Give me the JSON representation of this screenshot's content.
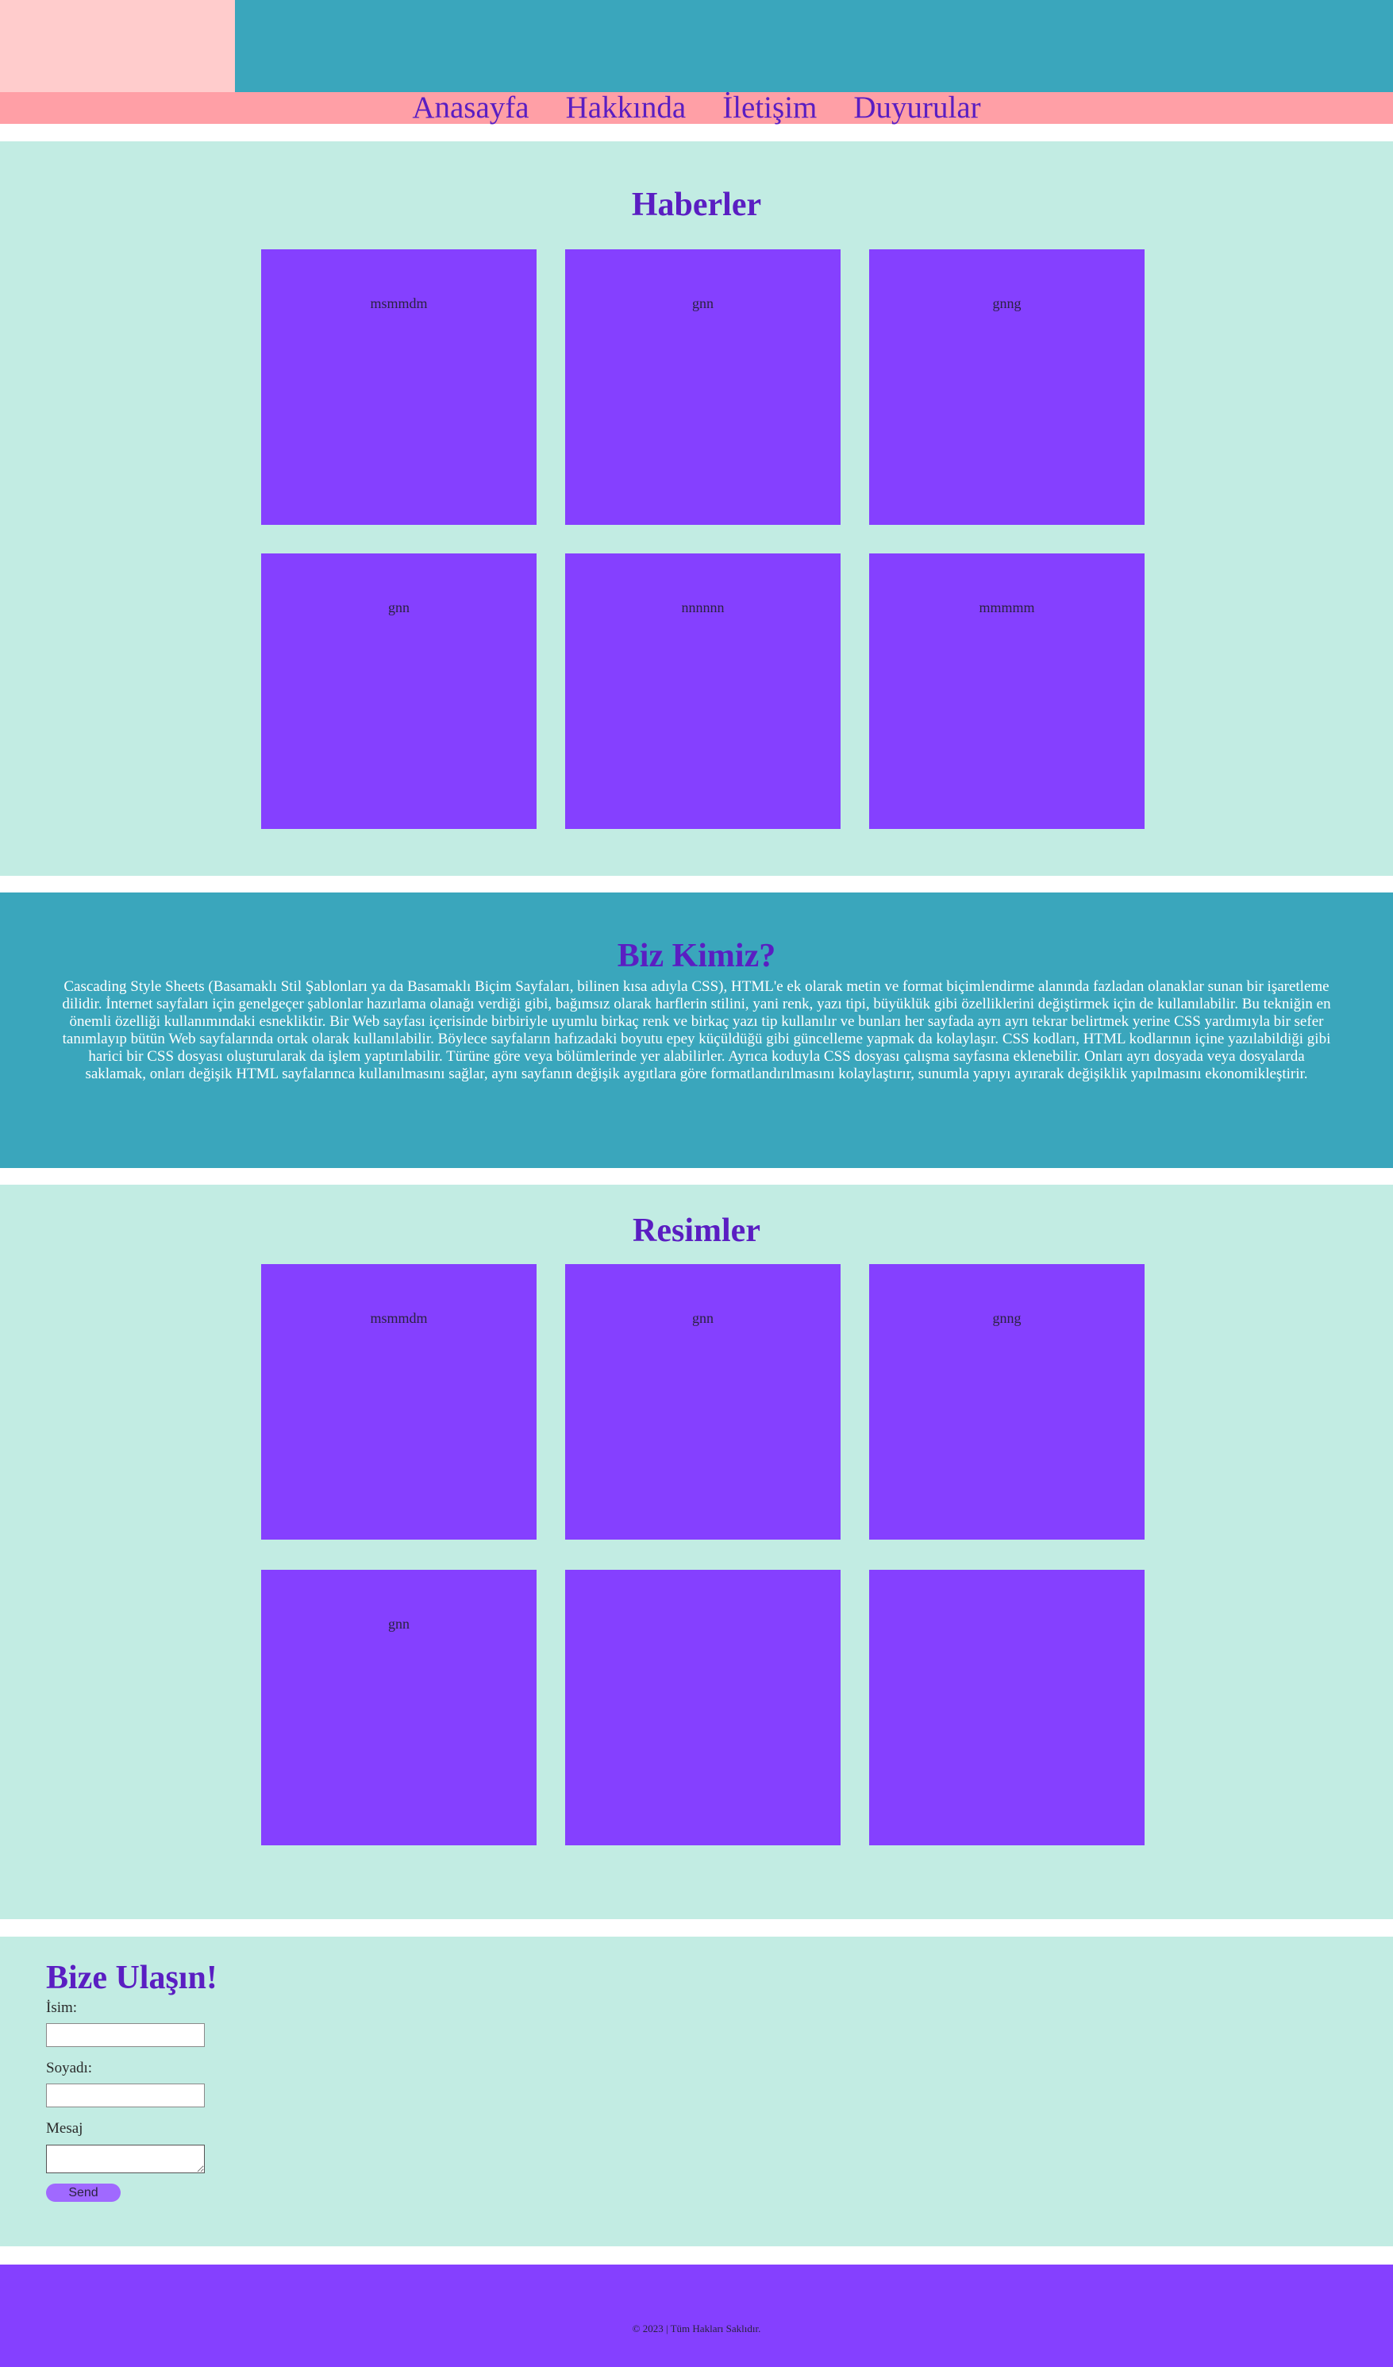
{
  "nav": {
    "links": [
      "Anasayfa",
      "Hakkında",
      "İletişim",
      "Duyurular"
    ]
  },
  "news": {
    "title": "Haberler",
    "cards": [
      "msmmdm",
      "gnn",
      "gnng",
      "gnn",
      "nnnnnn",
      "mmmmm"
    ]
  },
  "about": {
    "title": "Biz Kimiz?",
    "text": "Cascading Style Sheets (Basamaklı Stil Şablonları ya da Basamaklı Biçim Sayfaları, bilinen kısa adıyla CSS), HTML'e ek olarak metin ve format biçimlendirme alanında fazladan olanaklar sunan bir işaretleme dilidir. İnternet sayfaları için genelgeçer şablonlar hazırlama olanağı verdiği gibi, bağımsız olarak harflerin stilini, yani renk, yazı tipi, büyüklük gibi özelliklerini değiştirmek için de kullanılabilir. Bu tekniğin en önemli özelliği kullanımındaki esnekliktir. Bir Web sayfası içerisinde birbiriyle uyumlu birkaç renk ve birkaç yazı tip kullanılır ve bunları her sayfada ayrı ayrı tekrar belirtmek yerine CSS yardımıyla bir sefer tanımlayıp bütün Web sayfalarında ortak olarak kullanılabilir. Böylece sayfaların hafızadaki boyutu epey küçüldüğü gibi güncelleme yapmak da kolaylaşır. CSS kodları, HTML kodlarının içine yazılabildiği gibi harici bir CSS dosyası oluşturularak da işlem yaptırılabilir. Türüne göre veya bölümlerinde yer alabilirler. Ayrıca koduyla CSS dosyası çalışma sayfasına eklenebilir. Onları ayrı dosyada veya dosyalarda saklamak, onları değişik HTML sayfalarınca kullanılmasını sağlar, aynı sayfanın değişik aygıtlara göre formatlandırılmasını kolaylaştırır, sunumla yapıyı ayırarak değişiklik yapılmasını ekonomikleştirir."
  },
  "gallery": {
    "title": "Resimler",
    "cards": [
      "msmmdm",
      "gnn",
      "gnng",
      "gnn",
      "",
      ""
    ]
  },
  "contact": {
    "title": "Bize Ulaşın!",
    "name_label": "İsim:",
    "surname_label": "Soyadı:",
    "message_label": "Mesaj",
    "name_value": "",
    "surname_value": "",
    "message_value": "",
    "send_label": "Send"
  },
  "footer": {
    "text": "© 2023 | Tüm Hakları Saklıdır."
  },
  "colors": {
    "header": "#3aa6bc",
    "logo": "#ffcccc",
    "navbar": "#ff9fa6",
    "section_bg": "#c2ece3",
    "card": "#8540ff",
    "title": "#5a1ec2",
    "footer": "#8540ff"
  }
}
